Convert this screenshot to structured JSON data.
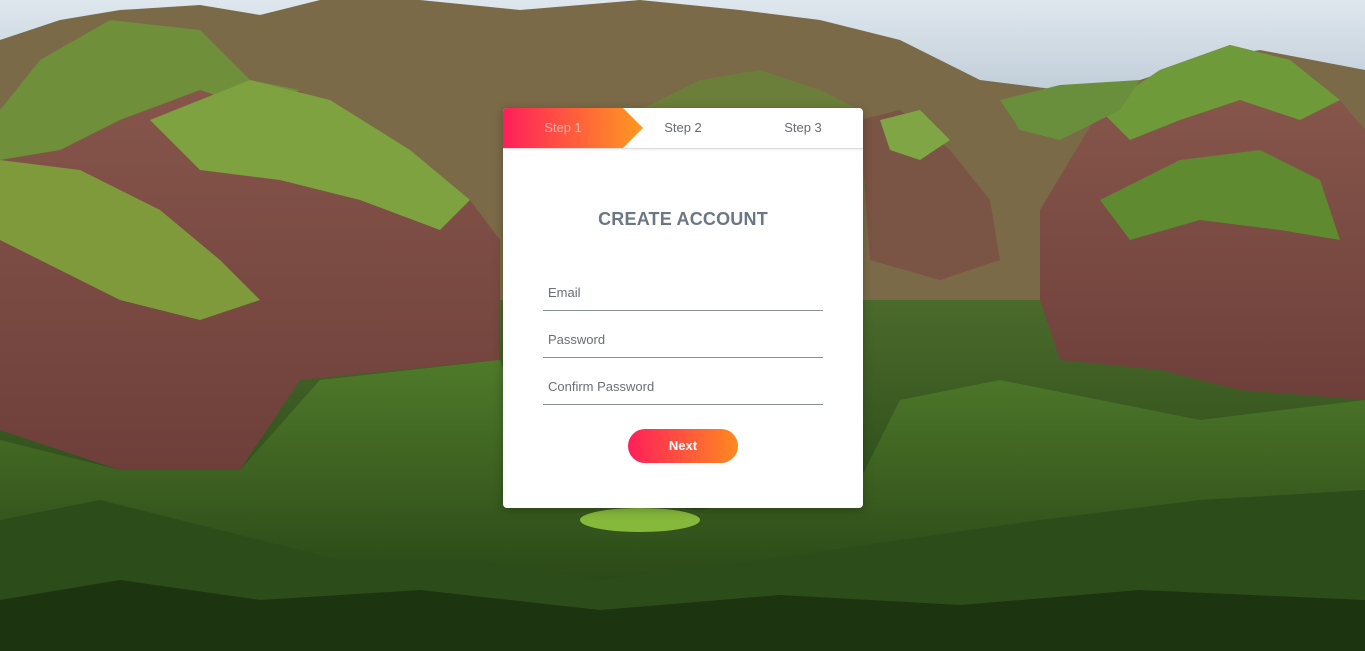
{
  "steps": [
    {
      "label": "Step 1",
      "active": true
    },
    {
      "label": "Step 2",
      "active": false
    },
    {
      "label": "Step 3",
      "active": false
    }
  ],
  "form": {
    "title": "CREATE ACCOUNT",
    "email_placeholder": "Email",
    "password_placeholder": "Password",
    "confirm_placeholder": "Confirm Password",
    "next_label": "Next"
  },
  "colors": {
    "gradient_start": "#ff1f5a",
    "gradient_end": "#ff8a1f",
    "title": "#6c7786"
  },
  "background": {
    "icon": "mountain-landscape-image"
  }
}
